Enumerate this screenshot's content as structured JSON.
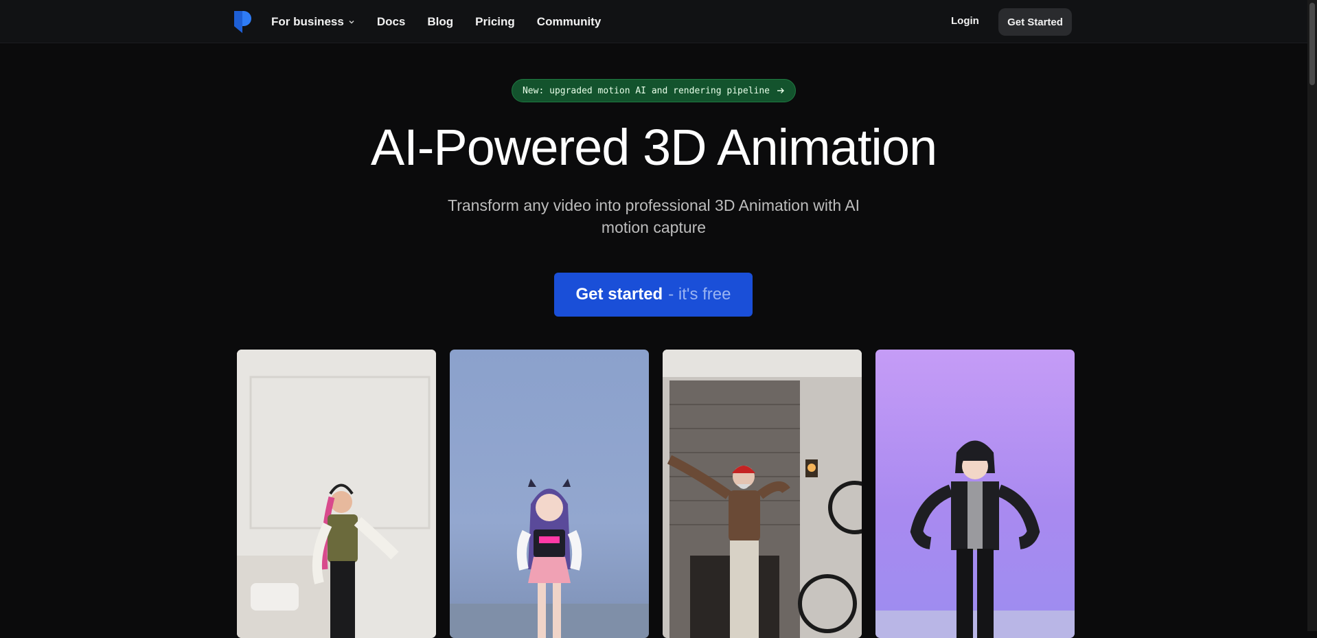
{
  "nav": {
    "links": [
      {
        "label": "For business",
        "has_dropdown": true
      },
      {
        "label": "Docs"
      },
      {
        "label": "Blog"
      },
      {
        "label": "Pricing"
      },
      {
        "label": "Community"
      }
    ],
    "login_label": "Login",
    "get_started_label": "Get Started"
  },
  "hero": {
    "announcement": "New: upgraded motion AI and rendering pipeline",
    "title": "AI-Powered 3D Animation",
    "subtitle": "Transform any video into professional 3D Animation with AI motion capture",
    "cta_main": "Get started",
    "cta_sub": "- it's free"
  },
  "cards": [
    {
      "type": "video",
      "subject": "woman-with-headphones-dancing"
    },
    {
      "type": "3d-avatar",
      "subject": "anime-girl-avatar"
    },
    {
      "type": "video",
      "subject": "man-with-red-beanie-dancing"
    },
    {
      "type": "3d-avatar",
      "subject": "anime-boy-avatar"
    }
  ],
  "colors": {
    "background": "#0b0b0c",
    "navbar": "#111214",
    "announcement_bg": "#13532d",
    "cta_bg": "#1a4fd8",
    "logo": "#2f7cf6"
  },
  "icons": {
    "logo": "brand-logo-icon",
    "dropdown": "chevron-down-icon",
    "arrow": "arrow-right-icon"
  }
}
